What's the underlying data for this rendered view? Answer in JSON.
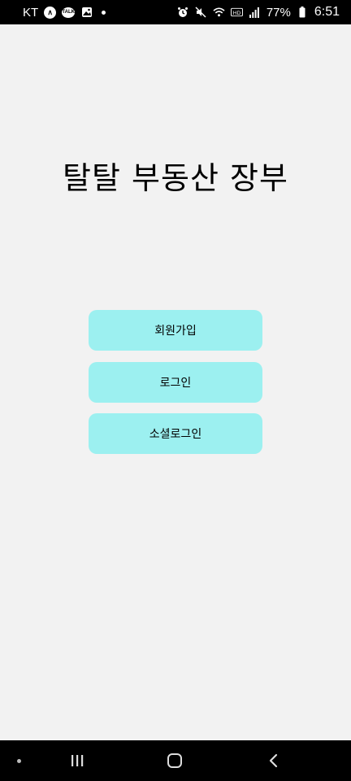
{
  "status_bar": {
    "carrier": "KT",
    "battery": "77%",
    "time": "6:51",
    "notification_icons": [
      "navigation-icon",
      "talk-icon",
      "image-icon",
      "more-dot"
    ],
    "system_icons": [
      "alarm-icon",
      "mute-icon",
      "wifi-icon",
      "volte-icon",
      "signal-icon",
      "battery-icon"
    ]
  },
  "main": {
    "title": "탈탈 부동산 장부",
    "buttons": {
      "signup": "회원가입",
      "login": "로그인",
      "social_login": "소셜로그인"
    },
    "button_color": "#9cf0f0",
    "background_color": "#f2f2f2"
  },
  "nav_bar": {
    "items": [
      "dot-icon",
      "recent-apps-icon",
      "home-icon",
      "back-icon"
    ]
  }
}
